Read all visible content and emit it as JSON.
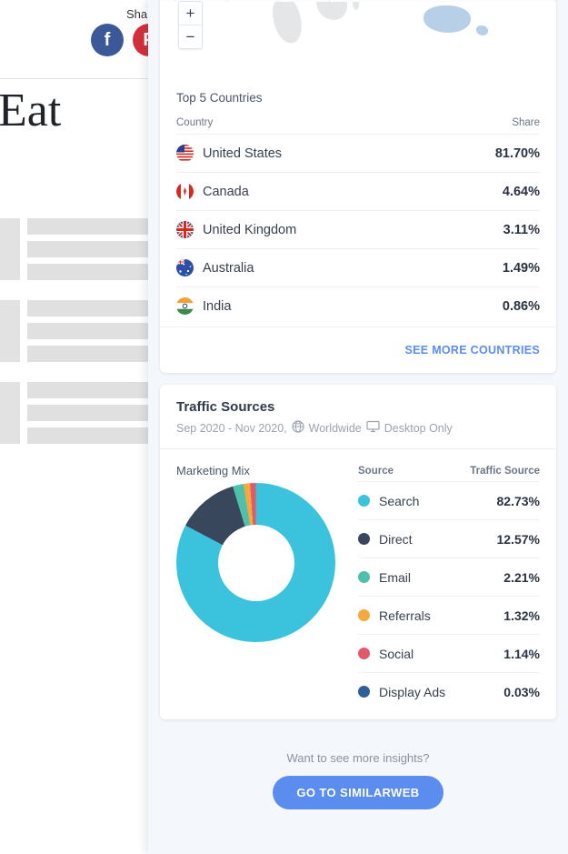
{
  "background_page": {
    "share_label": "Shar",
    "share_buttons": [
      {
        "name": "facebook",
        "glyph": "f",
        "color": "#3b5998"
      },
      {
        "name": "pinterest",
        "glyph": "P",
        "color": "#d32f3c"
      }
    ],
    "heading": "Eat"
  },
  "map": {
    "zoom_in_label": "+",
    "zoom_out_label": "−"
  },
  "countries_card": {
    "title": "Top 5 Countries",
    "col_country": "Country",
    "col_share": "Share",
    "rows": [
      {
        "country": "United States",
        "share": "81.70%",
        "flag": "us-flag-icon"
      },
      {
        "country": "Canada",
        "share": "4.64%",
        "flag": "ca-flag-icon"
      },
      {
        "country": "United Kingdom",
        "share": "3.11%",
        "flag": "uk-flag-icon"
      },
      {
        "country": "Australia",
        "share": "1.49%",
        "flag": "au-flag-icon"
      },
      {
        "country": "India",
        "share": "0.86%",
        "flag": "in-flag-icon"
      }
    ],
    "see_more": "SEE MORE COUNTRIES"
  },
  "traffic_card": {
    "title": "Traffic Sources",
    "date_range": "Sep 2020 - Nov 2020,",
    "scope": "Worldwide",
    "device": "Desktop Only",
    "mix_label": "Marketing Mix",
    "col_source": "Source",
    "col_value": "Traffic Source"
  },
  "chart_data": {
    "type": "pie",
    "title": "Marketing Mix",
    "categories": [
      "Search",
      "Direct",
      "Email",
      "Referrals",
      "Social",
      "Display Ads"
    ],
    "values": [
      82.73,
      12.57,
      2.21,
      1.32,
      1.14,
      0.03
    ],
    "value_labels": [
      "82.73%",
      "12.57%",
      "2.21%",
      "1.32%",
      "1.14%",
      "0.03%"
    ],
    "colors": [
      "#3bc3dd",
      "#39475c",
      "#4fc0ac",
      "#f5a83f",
      "#e05a6c",
      "#2f5f96"
    ],
    "legend_position": "right",
    "donut": true,
    "unit": "%"
  },
  "cta": {
    "text": "Want to see more insights?",
    "button": "GO TO SIMILARWEB"
  }
}
